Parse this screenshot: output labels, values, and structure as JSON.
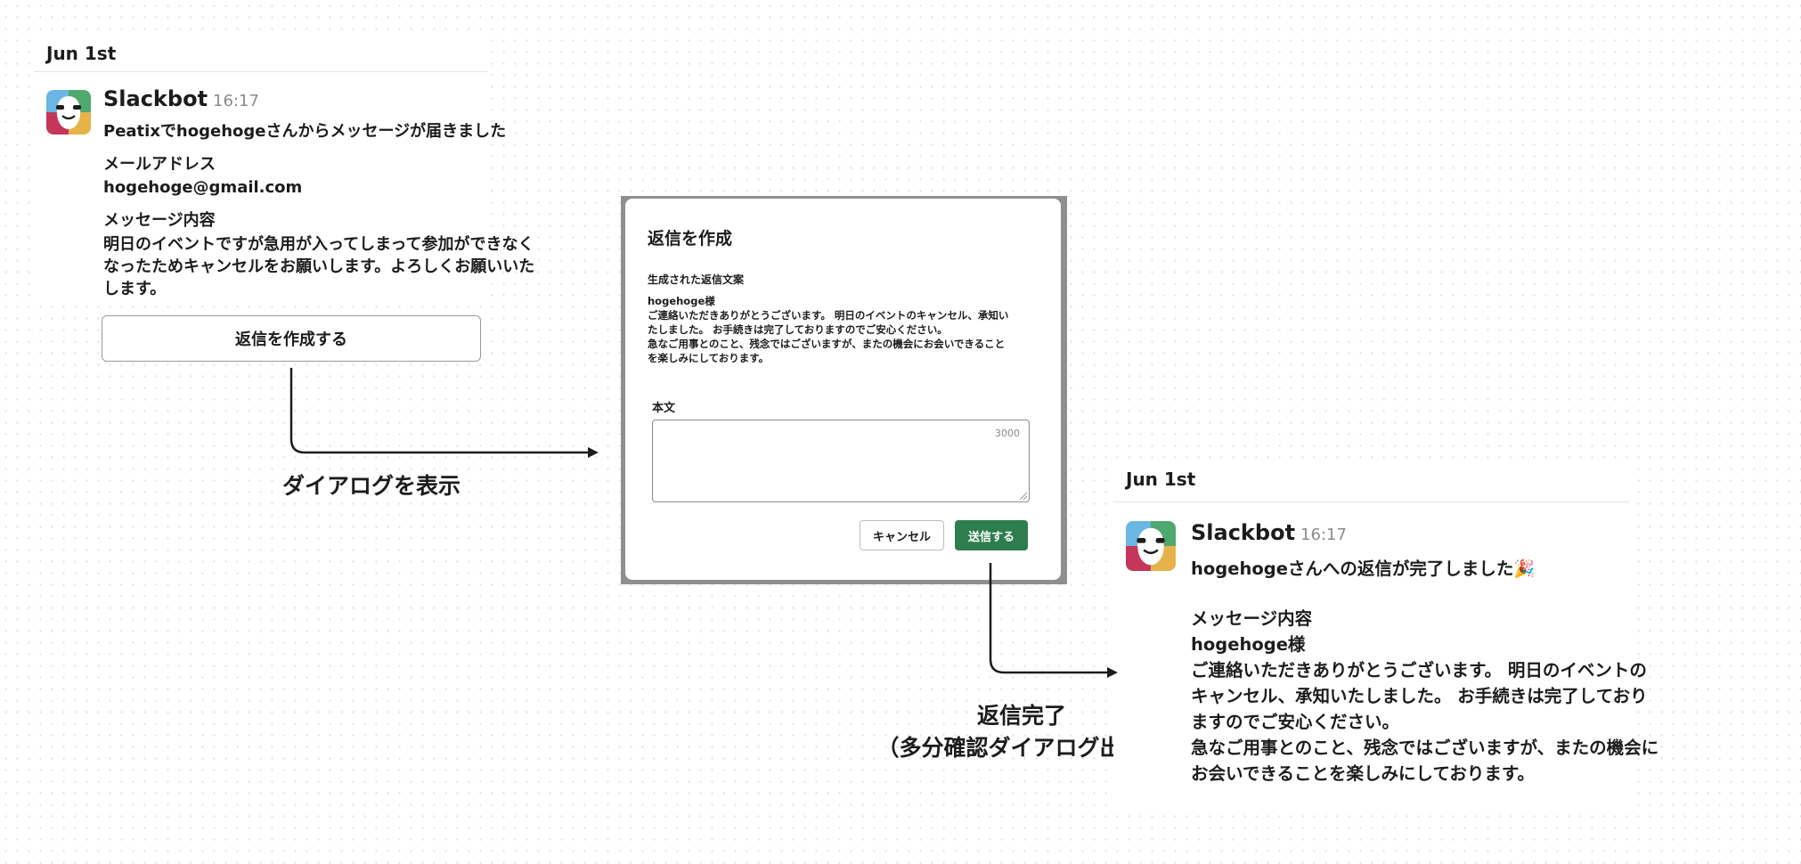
{
  "first_message": {
    "date": "Jun 1st",
    "sender": "Slackbot",
    "time": "16:17",
    "lines": [
      "Peatixでhogehogeさんからメッセージが届きました",
      "メールアドレス",
      "hogehoge@gmail.com",
      "メッセージ内容",
      "明日のイベントですが急用が入ってしまって参加ができなく",
      "なったためキャンセルをお願いします。よろしくお願いいた",
      "します。"
    ],
    "reply_button_label": "返信を作成する"
  },
  "step_labels": {
    "show_dialog": "ダイアログを表示",
    "reply_done_line1": "返信完了",
    "reply_done_line2": "（多分確認ダイアログ出す）"
  },
  "dialog": {
    "title": "返信を作成",
    "generated_label": "生成された返信文案",
    "generated_lines": [
      "hogehoge様",
      "ご連絡いただきありがとうございます。 明日のイベントのキャンセル、承知い",
      "たしました。 お手続きは完了しておりますのでご安心ください。",
      "急なご用事とのこと、残念ではございますが、またの機会にお会いできること",
      "を楽しみにしております。"
    ],
    "body_label": "本文",
    "char_limit": "3000",
    "cancel_label": "キャンセル",
    "send_label": "送信する"
  },
  "second_message": {
    "date": "Jun 1st",
    "sender": "Slackbot",
    "time": "16:17",
    "lines": [
      "hogehogeさんへの返信が完了しました🎉",
      "メッセージ内容",
      "hogehoge様",
      "ご連絡いただきありがとうございます。 明日のイベントの",
      "キャンセル、承知いたしました。 お手続きは完了しており",
      "ますのでご安心ください。",
      "急なご用事とのこと、残念ではございますが、またの機会に",
      "お会いできることを楽しみにしております。"
    ]
  },
  "colors": {
    "send_button": "#2e7d4f",
    "avatar_blue": "#6bb6e3",
    "avatar_green": "#4fa86e",
    "avatar_red": "#c4375a",
    "avatar_yellow": "#e6b24a"
  },
  "icons": {
    "avatar": "slackbot-avatar-icon"
  }
}
